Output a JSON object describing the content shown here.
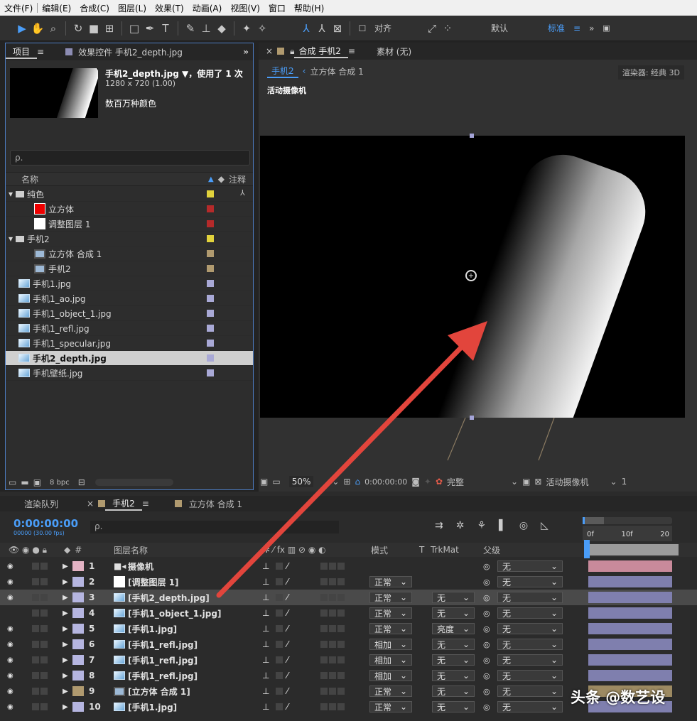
{
  "menu": [
    "文件(F)",
    "编辑(E)",
    "合成(C)",
    "图层(L)",
    "效果(T)",
    "动画(A)",
    "视图(V)",
    "窗口",
    "帮助(H)"
  ],
  "toolbar": {
    "align_label": "对齐",
    "workspace_default": "默认",
    "workspace_standard": "标准",
    "more": "»"
  },
  "project": {
    "tab_project": "项目",
    "tab_effects": "效果控件 手机2_depth.jpg",
    "more": "»",
    "file_name": "手机2_depth.jpg ▼，使用了 1 次",
    "file_dims": "1280 x 720 (1.00)",
    "file_colors": "数百万种颜色",
    "search_placeholder": "ρ.",
    "col_name": "名称",
    "col_comment": "注释",
    "bpc": "8 bpc",
    "items": [
      {
        "label": "纯色",
        "type": "folder",
        "color": "#e1d23c"
      },
      {
        "label": "立方体",
        "type": "solid-red",
        "color": "#b52a2a"
      },
      {
        "label": "调整图层 1",
        "type": "solid-white",
        "color": "#b52a2a"
      },
      {
        "label": "手机2",
        "type": "folder",
        "color": "#e1d23c"
      },
      {
        "label": "立方体 合成 1",
        "type": "comp",
        "color": "#b09a6f"
      },
      {
        "label": "手机2",
        "type": "comp",
        "color": "#b09a6f"
      },
      {
        "label": "手机1.jpg",
        "type": "image",
        "color": "#a9a9d6"
      },
      {
        "label": "手机1_ao.jpg",
        "type": "image",
        "color": "#a9a9d6"
      },
      {
        "label": "手机1_object_1.jpg",
        "type": "image",
        "color": "#a9a9d6"
      },
      {
        "label": "手机1_refl.jpg",
        "type": "image",
        "color": "#a9a9d6"
      },
      {
        "label": "手机1_specular.jpg",
        "type": "image",
        "color": "#a9a9d6"
      },
      {
        "label": "手机2_depth.jpg",
        "type": "image",
        "color": "#a9a9d6",
        "selected": true
      },
      {
        "label": "手机壁纸.jpg",
        "type": "image",
        "color": "#a9a9d6"
      }
    ]
  },
  "viewer": {
    "tab_comp": "合成 手机2",
    "tab_footage": "素材 (无)",
    "breadcrumb_1": "手机2",
    "breadcrumb_2": "立方体 合成 1",
    "renderer": "渲染器: 经典 3D",
    "camera_label": "活动摄像机",
    "zoom": "50%",
    "timecode": "0:00:00:00",
    "resolution": "完整",
    "view": "活动摄像机",
    "views_count": "1"
  },
  "timeline": {
    "tab_render": "渲染队列",
    "tab_comp1": "手机2",
    "tab_comp2": "立方体 合成 1",
    "timecode": "0:00:00:00",
    "frame_info": "00000 (30.00 fps)",
    "search_placeholder": "ρ.",
    "col_layer_name": "图层名称",
    "col_mode": "模式",
    "col_t": "T",
    "col_trkmat": "TrkMat",
    "col_parent": "父级",
    "ruler": [
      "0f",
      "10f",
      "20"
    ],
    "layers": [
      {
        "num": "1",
        "name": "摄像机",
        "type": "camera",
        "color": "#e3b3c4",
        "mode": "",
        "trkmat": "",
        "parent": "无",
        "bar": "#c98a9b"
      },
      {
        "num": "2",
        "name": "[调整图层 1]",
        "type": "solid-white",
        "color": "#b5b5e0",
        "mode": "正常",
        "trkmat": "",
        "parent": "无",
        "bar": "#7f7fae"
      },
      {
        "num": "3",
        "name": "[手机2_depth.jpg]",
        "type": "image",
        "color": "#b5b5e0",
        "mode": "正常",
        "trkmat": "无",
        "parent": "无",
        "bar": "#7f7fae",
        "selected": true
      },
      {
        "num": "4",
        "name": "[手机1_object_1.jpg]",
        "type": "image",
        "color": "#b5b5e0",
        "mode": "正常",
        "trkmat": "无",
        "parent": "无",
        "bar": "#7f7fae"
      },
      {
        "num": "5",
        "name": "[手机1.jpg]",
        "type": "image",
        "color": "#b5b5e0",
        "mode": "正常",
        "trkmat": "亮度",
        "parent": "无",
        "bar": "#7f7fae"
      },
      {
        "num": "6",
        "name": "[手机1_refl.jpg]",
        "type": "image",
        "color": "#b5b5e0",
        "mode": "相加",
        "trkmat": "无",
        "parent": "无",
        "bar": "#7f7fae"
      },
      {
        "num": "7",
        "name": "[手机1_refl.jpg]",
        "type": "image",
        "color": "#b5b5e0",
        "mode": "相加",
        "trkmat": "无",
        "parent": "无",
        "bar": "#7f7fae"
      },
      {
        "num": "8",
        "name": "[手机1_refl.jpg]",
        "type": "image",
        "color": "#b5b5e0",
        "mode": "相加",
        "trkmat": "无",
        "parent": "无",
        "bar": "#7f7fae"
      },
      {
        "num": "9",
        "name": "[立方体 合成 1]",
        "type": "comp",
        "color": "#b09a6f",
        "mode": "正常",
        "trkmat": "无",
        "parent": "无",
        "bar": "#9d8a62"
      },
      {
        "num": "10",
        "name": "[手机1.jpg]",
        "type": "image",
        "color": "#b5b5e0",
        "mode": "正常",
        "trkmat": "无",
        "parent": "无",
        "bar": "#7f7fae"
      }
    ]
  },
  "watermark": "头条 @数艺设",
  "accent_color": "#4a9df8",
  "arrow_color": "#e2453c"
}
